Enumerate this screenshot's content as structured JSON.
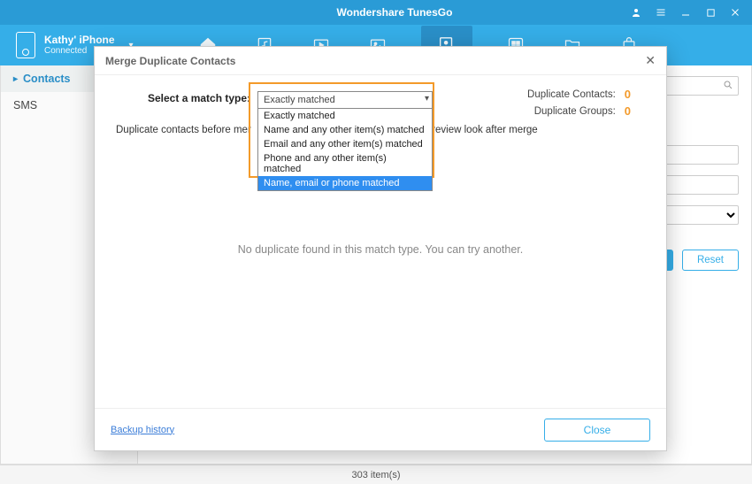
{
  "titlebar": {
    "title": "Wondershare TunesGo"
  },
  "device": {
    "name": "Kathy' iPhone",
    "status": "Connected"
  },
  "sidebar": {
    "items": [
      {
        "label": "Contacts",
        "active": true
      },
      {
        "label": "SMS",
        "active": false
      }
    ]
  },
  "main": {
    "reset_label": "Reset"
  },
  "statusbar": {
    "text": "303  item(s)"
  },
  "modal": {
    "title": "Merge Duplicate Contacts",
    "match_label": "Select a match type:",
    "selected_option": "Exactly matched",
    "options": [
      "Exactly matched",
      "Name and any other item(s) matched",
      "Email and any other item(s) matched",
      "Phone and any other item(s) matched",
      "Name, email or phone matched"
    ],
    "hovered_option_index": 4,
    "instruction_prefix": "Duplicate contacts before mer",
    "instruction_suffix": "review look after merge",
    "stats": {
      "contacts_label": "Duplicate Contacts:",
      "groups_label": "Duplicate Groups:",
      "contacts_count": "0",
      "groups_count": "0"
    },
    "empty_msg": "No duplicate found in this match type. You can try another.",
    "backup_link": "Backup history",
    "close_label": "Close"
  }
}
